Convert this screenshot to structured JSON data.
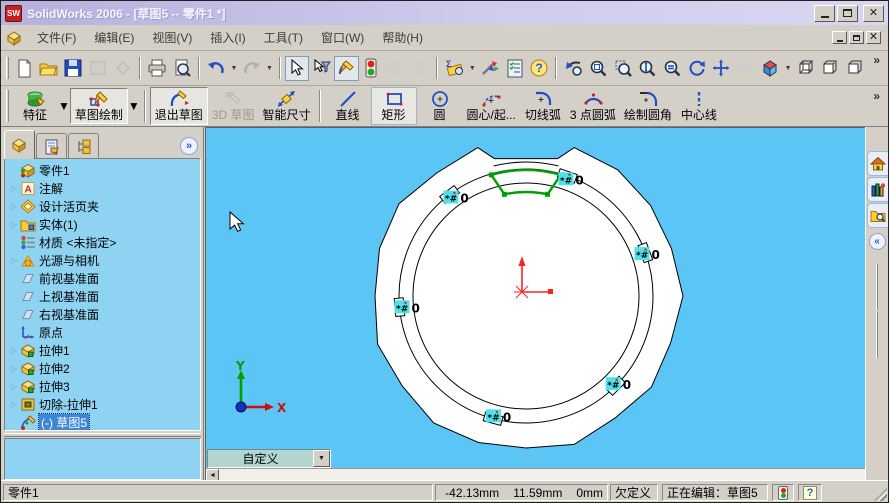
{
  "window": {
    "title": "SolidWorks 2006 - [草图5 -- 零件1 *]"
  },
  "menu_bar": {
    "items": [
      "文件(F)",
      "编辑(E)",
      "视图(V)",
      "插入(I)",
      "工具(T)",
      "窗口(W)",
      "帮助(H)"
    ]
  },
  "toolbars": {
    "sketch": {
      "feature": "特征",
      "sketch": "草图绘制",
      "exit_sketch": "退出草图",
      "sketch_3d": "3D 草图",
      "smart_dimension": "智能尺寸",
      "line": "直线",
      "rectangle": "矩形",
      "circle": "圆",
      "centerpoint_arc": "圆心/起...",
      "tangent_arc": "切线弧",
      "three_point_arc": "3 点圆弧",
      "sketch_fillet": "绘制圆角",
      "centerline": "中心线",
      "overflow": "»"
    }
  },
  "feature_tree": {
    "root_label": "零件1",
    "items": [
      {
        "label": "注解"
      },
      {
        "label": "设计活页夹"
      },
      {
        "label": "实体(1)"
      },
      {
        "label": "材质 <未指定>"
      },
      {
        "label": "光源与相机"
      },
      {
        "label": "前视基准面"
      },
      {
        "label": "上视基准面"
      },
      {
        "label": "右视基准面"
      },
      {
        "label": "原点"
      },
      {
        "label": "拉伸1"
      },
      {
        "label": "拉伸2"
      },
      {
        "label": "拉伸3"
      },
      {
        "label": "切除-拉伸1"
      },
      {
        "label": "(-) 草图5"
      }
    ]
  },
  "viewport": {
    "relation_badge_label": "0",
    "axis_x_label": "X",
    "axis_y_label": "Y",
    "view_combo_value": "自定义"
  },
  "status_bar": {
    "left_text": "零件1",
    "coord_x": "-42.13mm",
    "coord_y": "11.59mm",
    "coord_z": "0mm",
    "definition_state": "欠定义",
    "editing_text": "正在编辑：草图5"
  },
  "colors": {
    "viewport_bg": "#5BC6F6",
    "tree_bg": "#8FD3F2",
    "selection_blue": "#3C86D8",
    "sketch_green": "#00A000",
    "relation_cyan": "#4DE3EE",
    "origin_red": "#FF2020",
    "titlebar_lavender": "#CFCBEC"
  },
  "icons": {
    "new": "blank-page",
    "open": "folder",
    "save": "floppy-disk",
    "print": "printer",
    "print_preview": "page-magnifier",
    "undo": "curved-arrow-left",
    "redo": "curved-arrow-right",
    "select": "cursor-arrow",
    "rebuild": "traffic-light",
    "options": "checklist",
    "help": "question-mark",
    "zoom_fit": "magnifier",
    "rotate_view": "circular-arrows",
    "pan": "cross-arrows",
    "display_style": "shaded-cube",
    "overflow": "double-chevron"
  }
}
